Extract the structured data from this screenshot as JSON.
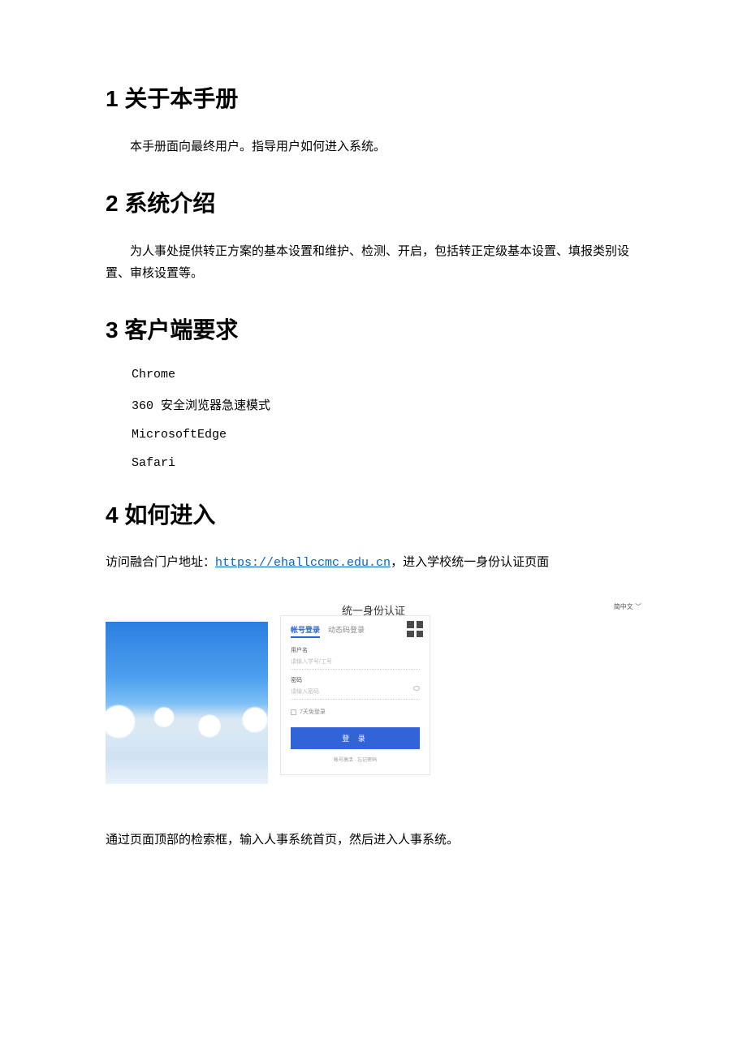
{
  "section1": {
    "title": "1 关于本手册",
    "body": "本手册面向最终用户。指导用户如何进入系统。"
  },
  "section2": {
    "title": "2 系统介绍",
    "body": "为人事处提供转正方案的基本设置和维护、检测、开启，包括转正定级基本设置、填报类别设置、审核设置等。"
  },
  "section3": {
    "title": "3 客户端要求",
    "browsers": [
      "Chrome",
      "360 安全浏览器急速模式",
      "MicrosoftEdge",
      "Safari"
    ]
  },
  "section4": {
    "title": "4 如何进入",
    "url_prefix": "访问融合门户地址：",
    "url": "https://ehallccmc.edu.cn",
    "url_suffix": "，进入学校统一身份认证页面",
    "after_login": "通过页面顶部的检索框，输入人事系统首页，然后进入人事系统。"
  },
  "login": {
    "title": "统一身份认证",
    "tab_active": "帐号登录",
    "tab_inactive": "动态码登录",
    "username_label": "用户名",
    "username_placeholder": "请输入学号/工号",
    "password_label": "密码",
    "password_placeholder": "请输入密码",
    "remember": "7天免登录",
    "button": "登 录",
    "footer": "帐号激活 · 忘记密码",
    "lang": "简中文"
  }
}
